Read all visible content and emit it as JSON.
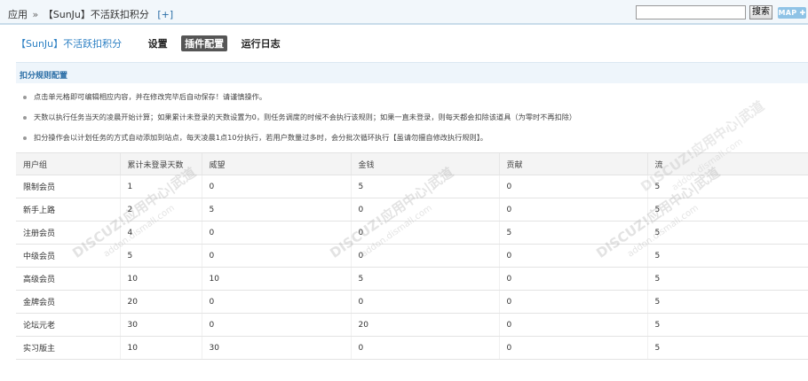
{
  "topbar": {
    "crumb_root": "应用",
    "crumb_sep": "»",
    "crumb_current": "【SunJu】不活跃扣积分",
    "crumb_add": "[+]",
    "search_placeholder": "",
    "search_label": "搜索",
    "map_label": "MAP ✚"
  },
  "nav": {
    "plugin_title": "【SunJu】不活跃扣积分",
    "tabs": [
      "设置",
      "插件配置",
      "运行日志"
    ]
  },
  "section": {
    "title": "扣分规则配置"
  },
  "notes": [
    "点击单元格即可编辑相应内容，并在修改完毕后自动保存！请谨慎操作。",
    "天数以执行任务当天的凌晨开始计算；如果累计未登录的天数设置为0，则任务调度的时候不会执行该规则；如果一直未登录，则每天都会扣除该道具（为零时不再扣除）",
    "扣分操作会以计划任务的方式自动添加到站点，每天凌晨1点10分执行，若用户数量过多时，会分批次循环执行【虽请勿擅自修改执行规则】。"
  ],
  "table": {
    "headers": [
      "用户组",
      "累计未登录天数",
      "威望",
      "金钱",
      "贡献",
      "流"
    ],
    "rows": [
      [
        "限制会员",
        "1",
        "0",
        "5",
        "0",
        "5"
      ],
      [
        "新手上路",
        "2",
        "5",
        "0",
        "0",
        "5"
      ],
      [
        "注册会员",
        "4",
        "0",
        "0",
        "5",
        "5"
      ],
      [
        "中级会员",
        "5",
        "0",
        "0",
        "0",
        "5"
      ],
      [
        "高级会员",
        "10",
        "10",
        "5",
        "0",
        "5"
      ],
      [
        "金牌会员",
        "20",
        "0",
        "0",
        "0",
        "5"
      ],
      [
        "论坛元老",
        "30",
        "0",
        "20",
        "0",
        "5"
      ],
      [
        "实习版主",
        "10",
        "30",
        "0",
        "0",
        "5"
      ]
    ]
  },
  "watermark": {
    "line1": "DISCUZ!应用中心|武道",
    "line2": "addon.dismall.com"
  }
}
